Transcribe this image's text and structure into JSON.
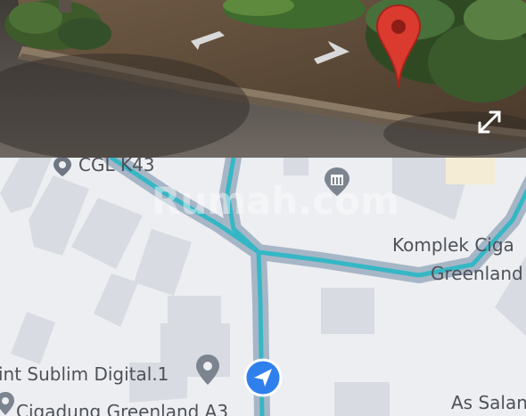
{
  "street_view": {
    "expand_icon": "expand-arrows-icon",
    "marker_icon": "red-location-pin-icon",
    "marker_color": "#db3a2f"
  },
  "map": {
    "labels": {
      "poi_cgl": "CGL K43",
      "komplek_line1": "Komplek Ciga",
      "komplek_line2": "Greenland",
      "print_sublim": "int Sublim Digital.1",
      "cigadung": "Cigadung Greenland A3",
      "as_salam": "As Salan"
    },
    "watermark": "Rumah.com",
    "route_color": "#35b7c5",
    "road_color": "#a7b6c6",
    "nav_icon": "navigation-arrow-icon",
    "nav_color": "#2f80ed",
    "poi_icons": [
      "location-pin-icon",
      "museum-pin-icon",
      "location-pin-icon",
      "location-pin-icon"
    ]
  }
}
